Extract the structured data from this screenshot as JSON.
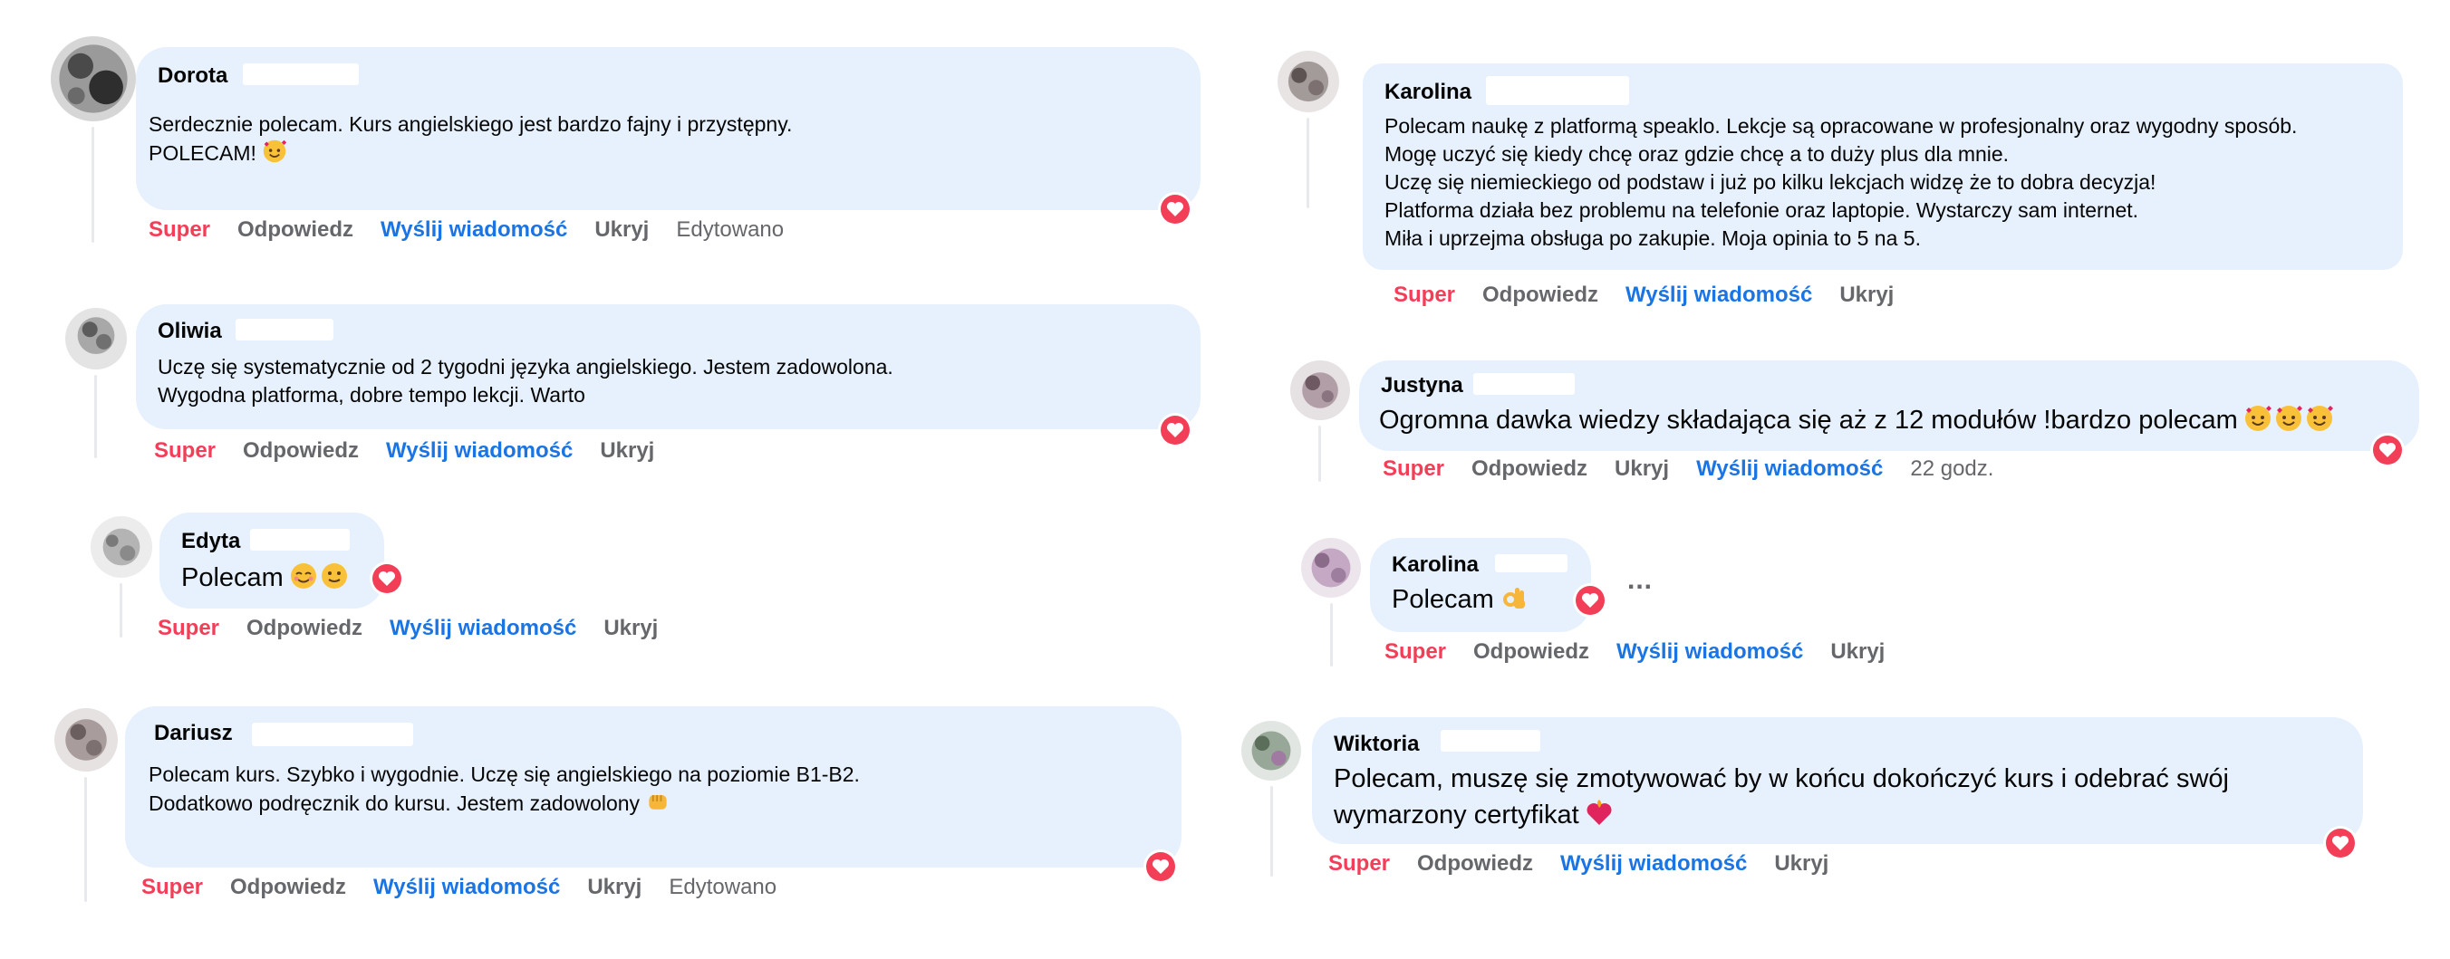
{
  "colors": {
    "bubble": "#e6f1fd",
    "super": "#f33e58",
    "message_link": "#1b74e4",
    "muted": "#65676b",
    "reaction": "#f33e58"
  },
  "icons": {
    "reaction": "heart-icon",
    "more": "more-options-icon"
  },
  "actions": {
    "super": "Super",
    "reply": "Odpowiedz",
    "message": "Wyślij wiadomość",
    "hide": "Ukryj",
    "edited": "Edytowano"
  },
  "comments": [
    {
      "author": "Dorota",
      "lines": [
        "Serdecznie polecam. Kurs angielskiego jest bardzo fajny i przystępny.",
        "POLECAM!"
      ],
      "emoji": [
        "smiling-face-with-hearts"
      ],
      "edited": "Edytowano"
    },
    {
      "author": "Oliwia",
      "lines": [
        "Uczę się systematycznie od 2 tygodni języka angielskiego. Jestem zadowolona.",
        "Wygodna platforma, dobre tempo lekcji. Warto"
      ]
    },
    {
      "author": "Edyta",
      "lines": [
        "Polecam"
      ],
      "emoji": [
        "smiling-face-blush",
        "slightly-smiling-face"
      ]
    },
    {
      "author": "Dariusz",
      "lines": [
        "Polecam kurs. Szybko i wygodnie. Uczę się angielskiego na poziomie B1-B2.",
        "Dodatkowo podręcznik do kursu. Jestem zadowolony"
      ],
      "emoji": [
        "fist"
      ],
      "edited": "Edytowano"
    },
    {
      "author": "Karolina",
      "lines": [
        "Polecam naukę z platformą speaklo. Lekcje są opracowane w profesjonalny oraz wygodny sposób.",
        "Mogę uczyć się kiedy chcę oraz gdzie chcę a to duży plus dla mnie.",
        "Uczę się niemieckiego od podstaw i już po kilku lekcjach widzę że to dobra decyzja!",
        "Platforma działa bez problemu na telefonie oraz laptopie. Wystarczy sam internet.",
        "Miła i uprzejma obsługa po zakupie. Moja opinia to 5 na 5."
      ]
    },
    {
      "author": "Justyna",
      "lines": [
        "Ogromna dawka wiedzy składająca się aż z 12 modułów !bardzo polecam"
      ],
      "emoji": [
        "smiling-face-with-hearts",
        "smiling-face-with-hearts",
        "smiling-face-with-hearts"
      ],
      "time": "22 godz."
    },
    {
      "author": "Karolina",
      "lines": [
        "Polecam"
      ],
      "emoji": [
        "ok-hand"
      ],
      "more": "..."
    },
    {
      "author": "Wiktoria",
      "lines": [
        "Polecam, muszę się zmotywować by w końcu dokończyć kurs i odebrać swój",
        "wymarzony certyfikat"
      ],
      "emoji": [
        "heart-on-fire"
      ]
    }
  ]
}
